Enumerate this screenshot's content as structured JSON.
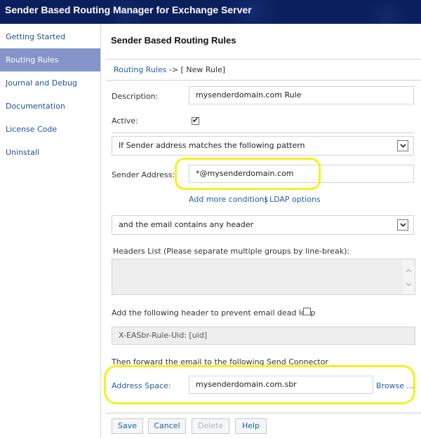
{
  "window": {
    "title": "Sender Based Routing Manager for Exchange Server"
  },
  "sidebar": {
    "items": [
      {
        "label": "Getting Started",
        "active": false
      },
      {
        "label": "Routing Rules",
        "active": true
      },
      {
        "label": "Journal and Debug",
        "active": false
      },
      {
        "label": "Documentation",
        "active": false
      },
      {
        "label": "License Code",
        "active": false
      },
      {
        "label": "Uninstall",
        "active": false
      }
    ]
  },
  "main": {
    "title": "Sender Based Routing Rules",
    "breadcrumb": {
      "link": "Routing Rules",
      "separator": " -> ",
      "current": "[ New Rule]"
    },
    "description": {
      "label": "Description:",
      "value": "mysenderdomain.com Rule"
    },
    "active": {
      "label": "Active:",
      "checked": true,
      "mark": "✔"
    },
    "condition_select": {
      "value": "If Sender address matches the following pattern"
    },
    "sender_address": {
      "label": "Sender Address:",
      "value": "*@mysenderdomain.com"
    },
    "links": {
      "add_conditions": "Add more conditions",
      "separator": "|",
      "ldap": "LDAP options"
    },
    "header_select": {
      "value": "and the email contains any header"
    },
    "headers_list": {
      "label": "Headers List (Please separate multiple groups by line-break):",
      "value": ""
    },
    "dead_loop": {
      "label": "Add the following header to prevent email dead loop",
      "checked": false,
      "header_value": "X-EASbr-Rule-Uid: [uid]"
    },
    "forward": {
      "label": "Then forward the email to the following Send Connector",
      "address_space_label": "Address Space:",
      "address_space_value": "mysenderdomain.com.sbr",
      "browse_label": "Browse ..."
    },
    "buttons": {
      "save": "Save",
      "cancel": "Cancel",
      "delete": "Delete",
      "help": "Help"
    },
    "highlight_color": "#f5ef1f"
  }
}
